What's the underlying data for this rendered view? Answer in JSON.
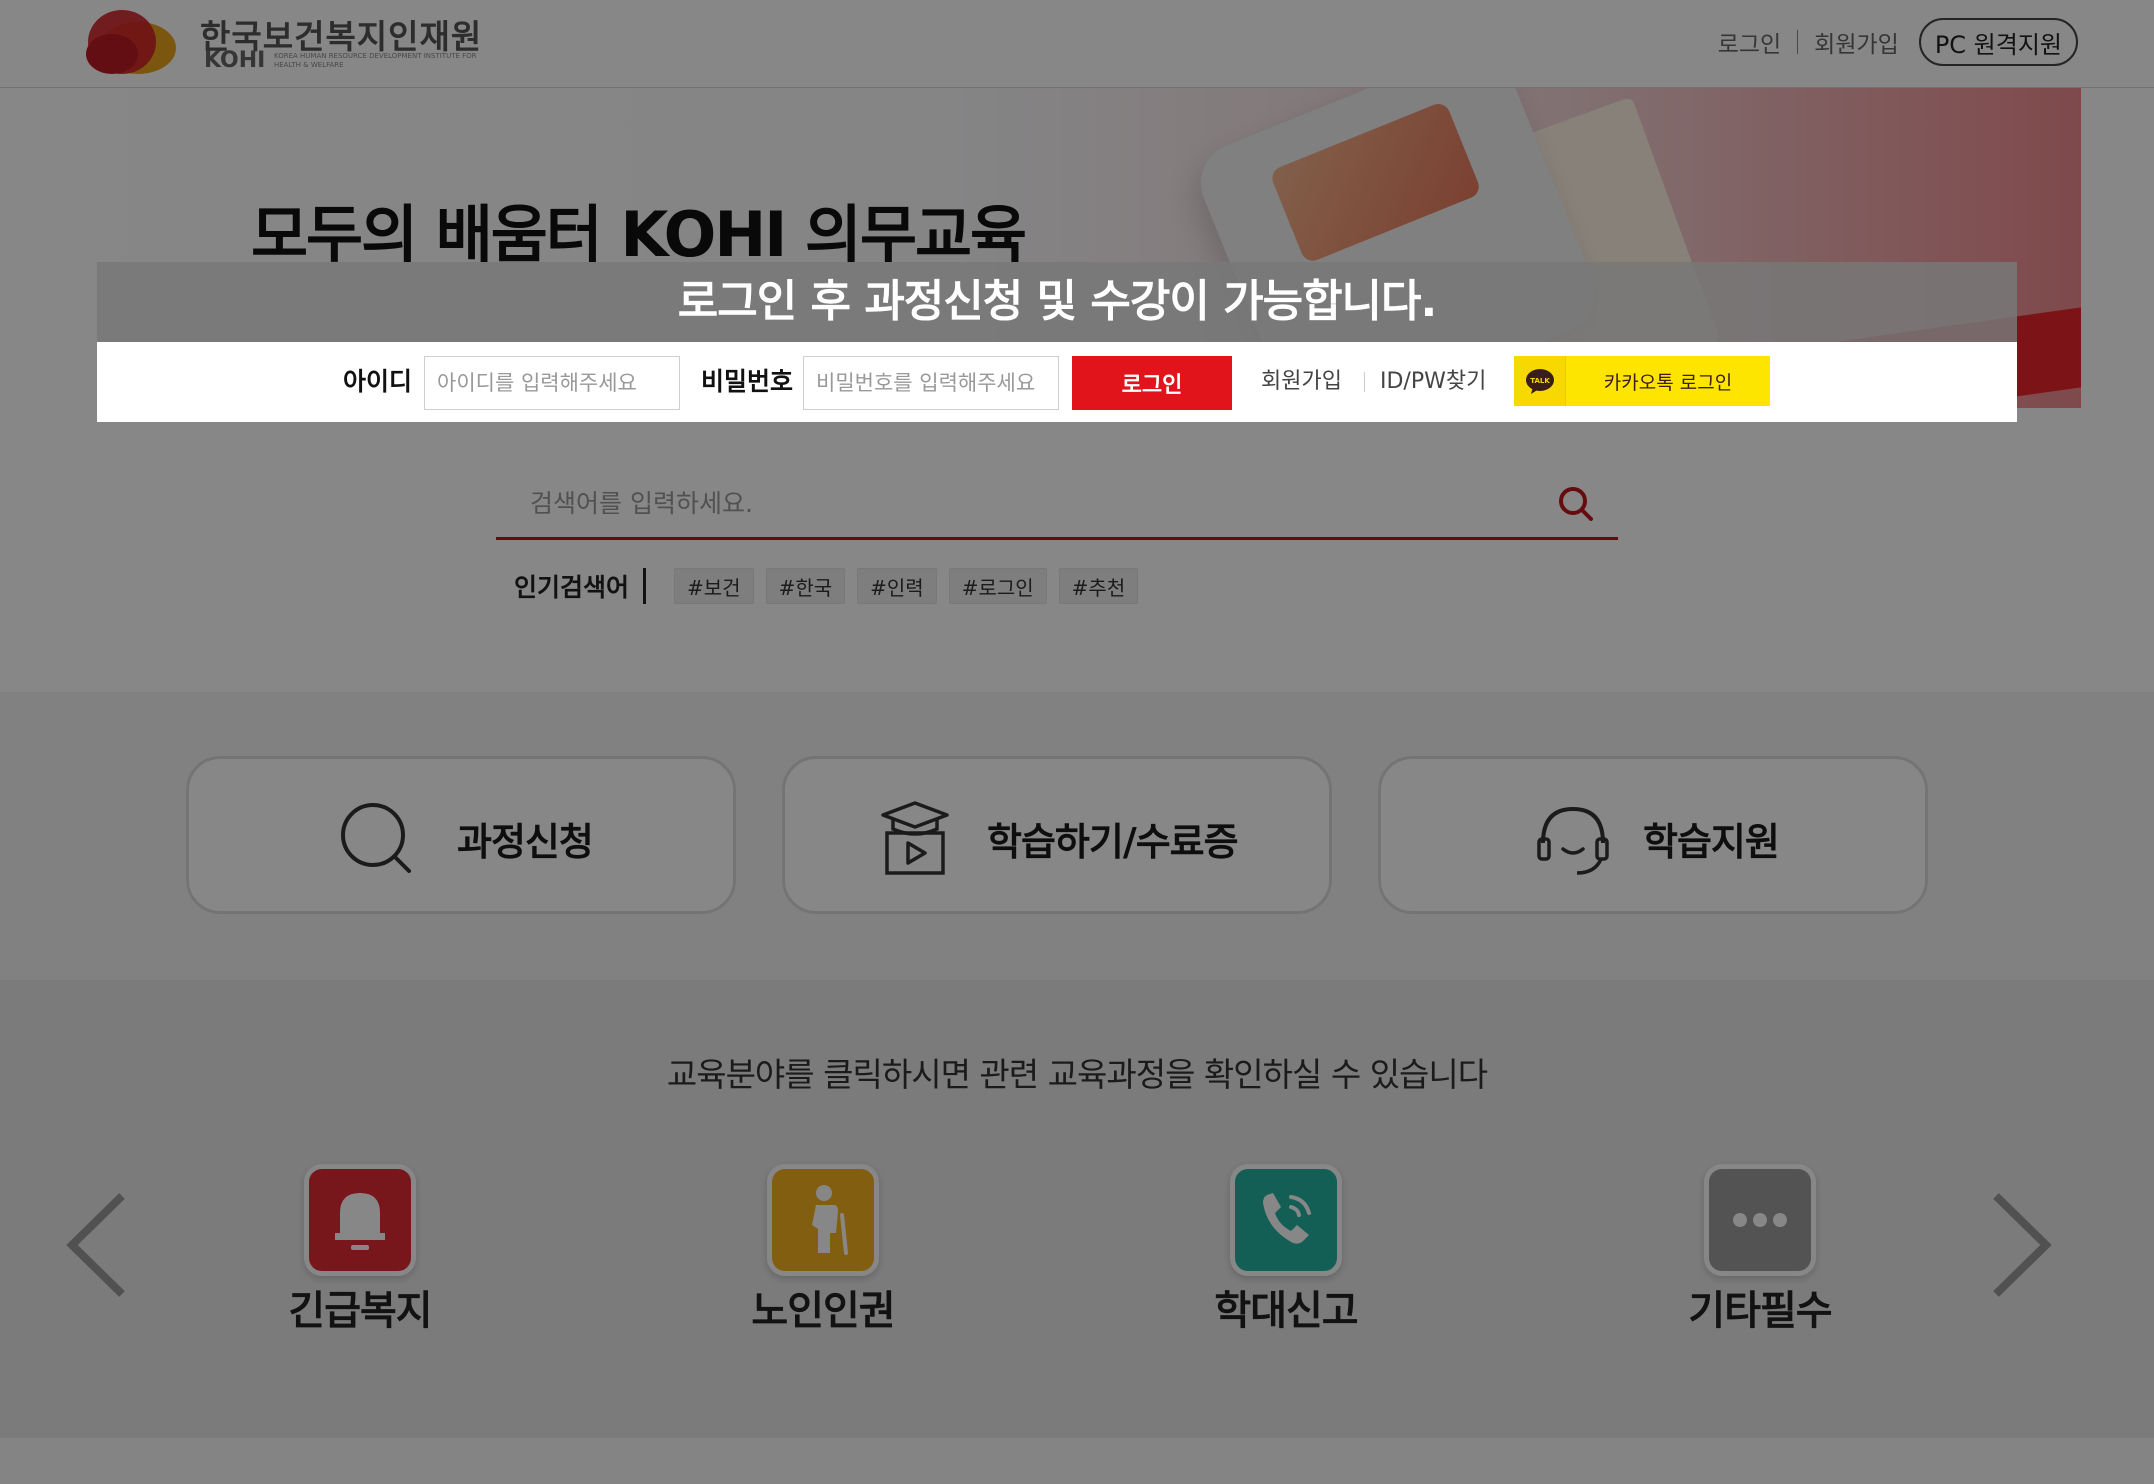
{
  "header": {
    "logo_kr": "한국보건복지인재원",
    "logo_en": "KOHI",
    "logo_en_small": "KOREA HUMAN RESOURCE DEVELOPMENT INSTITUTE FOR HEALTH & WELFARE",
    "links": {
      "login": "로그인",
      "signup": "회원가입"
    },
    "pc_support": "PC 원격지원"
  },
  "banner": {
    "title": "모두의 배움터 KOHI 의무교육"
  },
  "login_overlay": {
    "notice": "로그인 후 과정신청 및 수강이 가능합니다.",
    "id_label": "아이디",
    "id_placeholder": "아이디를 입력해주세요",
    "pw_label": "비밀번호",
    "pw_placeholder": "비밀번호를 입력해주세요",
    "login_button": "로그인",
    "signup_link": "회원가입",
    "find_link": "ID/PW찾기",
    "kakao_button": "카카오톡 로그인",
    "kakao_icon_text": "TALK"
  },
  "search": {
    "placeholder": "검색어를 입력하세요.",
    "popular_label": "인기검색어",
    "tags": [
      "#보건",
      "#한국",
      "#인력",
      "#로그인",
      "#추천"
    ]
  },
  "quick_menu": [
    {
      "label": "과정신청",
      "icon": "search-icon"
    },
    {
      "label": "학습하기/수료증",
      "icon": "graduation-video-icon"
    },
    {
      "label": "학습지원",
      "icon": "headset-icon"
    }
  ],
  "categories": {
    "description": "교육분야를 클릭하시면 관련 교육과정을 확인하실 수 있습니다",
    "items": [
      {
        "label": "긴급복지",
        "icon": "bell-icon",
        "color": "#e02a33"
      },
      {
        "label": "노인인권",
        "icon": "elderly-person-icon",
        "color": "#f5b31f"
      },
      {
        "label": "학대신고",
        "icon": "phone-icon",
        "color": "#25b3a3"
      },
      {
        "label": "기타필수",
        "icon": "more-dots-icon",
        "color": "#9e9e9e"
      }
    ]
  },
  "colors": {
    "brand_red": "#e1141c",
    "search_underline": "#c4161c",
    "kakao_yellow": "#fee500"
  }
}
